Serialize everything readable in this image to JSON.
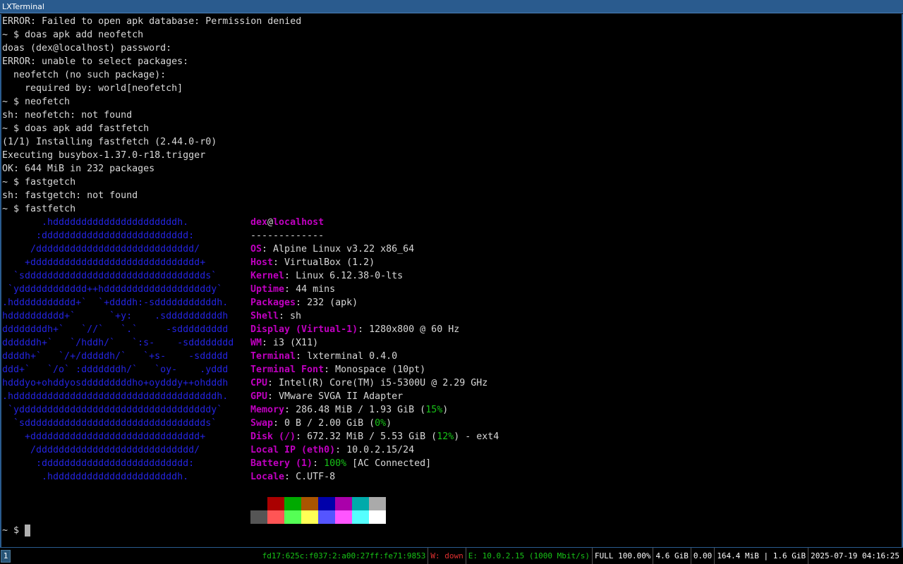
{
  "window": {
    "title": "LXTerminal"
  },
  "terminal": {
    "lines": [
      "ERROR: Failed to open apk database: Permission denied",
      "~ $ doas apk add neofetch",
      "doas (dex@localhost) password:",
      "ERROR: unable to select packages:",
      "  neofetch (no such package):",
      "    required by: world[neofetch]",
      "~ $ neofetch",
      "sh: neofetch: not found",
      "~ $ doas apk add fastfetch",
      "(1/1) Installing fastfetch (2.44.0-r0)",
      "Executing busybox-1.37.0-r18.trigger",
      "OK: 644 MiB in 232 packages",
      "~ $ fastgetch",
      "sh: fastgetch: not found",
      "~ $ fastfetch"
    ],
    "logo_color": "#2424e0",
    "logo": [
      "       .hddddddddddddddddddddddh.",
      "      :dddddddddddddddddddddddddd:",
      "     /dddddddddddddddddddddddddddd/",
      "    +dddddddddddddddddddddddddddddd+",
      "  `sdddddddddddddddddddddddddddddddds`",
      " `ydddddddddddd++hdddddddddddddddddddy`",
      ".hddddddddddd+`  `+ddddh:-sdddddddddddh.",
      "hdddddddddd+`      `+y:    .sddddddddddh",
      "ddddddddh+`   `//`   `.`     -sddddddddd",
      "ddddddh+`   `/hddh/`   `:s-    -sdddddddd",
      "ddddh+`   `/+/dddddh/`   `+s-    -sddddd",
      "ddd+`   `/o` :dddddddh/`   `oy-    .yddd",
      "hdddyo+ohddyosdddddddddho+oydddy++ohdddh",
      ".hddddddddddddddddddddddddddddddddddddh.",
      " `yddddddddddddddddddddddddddddddddddy`",
      "  `sdddddddddddddddddddddddddddddddds`",
      "    +dddddddddddddddddddddddddddddd+",
      "     /dddddddddddddddddddddddddddd/",
      "      :dddddddddddddddddddddddddd:",
      "       .hddddddddddddddddddddddh."
    ],
    "fastfetch": {
      "user": "dex",
      "at": "@",
      "host": "localhost",
      "separator": "-------------",
      "items": [
        {
          "key": "OS",
          "colon": ": ",
          "value": "Alpine Linux v3.22 x86_64"
        },
        {
          "key": "Host",
          "colon": ": ",
          "value": "VirtualBox (1.2)"
        },
        {
          "key": "Kernel",
          "colon": ": ",
          "value": "Linux 6.12.38-0-lts"
        },
        {
          "key": "Uptime",
          "colon": ": ",
          "value": "44 mins"
        },
        {
          "key": "Packages",
          "colon": ": ",
          "value": "232 (apk)"
        },
        {
          "key": "Shell",
          "colon": ": ",
          "value": "sh"
        },
        {
          "key": "Display (Virtual-1)",
          "colon": ": ",
          "value": "1280x800 @ 60 Hz"
        },
        {
          "key": "WM",
          "colon": ": ",
          "value": "i3 (X11)"
        },
        {
          "key": "Terminal",
          "colon": ": ",
          "value": "lxterminal 0.4.0"
        },
        {
          "key": "Terminal Font",
          "colon": ": ",
          "value": "Monospace (10pt)"
        },
        {
          "key": "CPU",
          "colon": ": ",
          "value": "Intel(R) Core(TM) i5-5300U @ 2.29 GHz"
        },
        {
          "key": "GPU",
          "colon": ": ",
          "value": "VMware SVGA II Adapter"
        },
        {
          "key": "Memory",
          "colon": ": ",
          "value": "286.48 MiB / 1.93 GiB (",
          "pct": "15%",
          "tail": ")"
        },
        {
          "key": "Swap",
          "colon": ": ",
          "value": "0 B / 2.00 GiB (",
          "pct": "0%",
          "tail": ")"
        },
        {
          "key": "Disk (/)",
          "colon": ": ",
          "value": "672.32 MiB / 5.53 GiB (",
          "pct": "12%",
          "tail": ") - ext4"
        },
        {
          "key": "Local IP (eth0)",
          "colon": ": ",
          "value": "10.0.2.15/24"
        },
        {
          "key": "Battery (1)",
          "colon": ": ",
          "value": "",
          "pct": "100%",
          "tail": " [AC Connected]"
        },
        {
          "key": "Locale",
          "colon": ": ",
          "value": "C.UTF-8"
        }
      ],
      "palette_top": [
        "#000000",
        "#aa0000",
        "#00aa00",
        "#aa5500",
        "#0000aa",
        "#aa00aa",
        "#00aaaa",
        "#aaaaaa"
      ],
      "palette_bottom": [
        "#555555",
        "#ff5555",
        "#55ff55",
        "#ffff55",
        "#5555ff",
        "#ff55ff",
        "#55ffff",
        "#ffffff"
      ]
    },
    "prompt": "~ $ "
  },
  "statusbar": {
    "workspace": "1",
    "items": [
      {
        "text": "fd17:625c:f037:2:a00:27ff:fe71:9853",
        "color": "#17c317"
      },
      {
        "text": "W: down",
        "color": "#e03030"
      },
      {
        "text": "E: 10.0.2.15 (1000 Mbit/s)",
        "color": "#17c317"
      },
      {
        "text": "FULL 100.00%",
        "color": "#ffffff"
      },
      {
        "text": "4.6 GiB",
        "color": "#ffffff"
      },
      {
        "text": "0.00",
        "color": "#ffffff"
      },
      {
        "text": "164.4 MiB | 1.6 GiB",
        "color": "#ffffff"
      },
      {
        "text": "2025-07-19 04:16:25",
        "color": "#ffffff"
      }
    ]
  }
}
